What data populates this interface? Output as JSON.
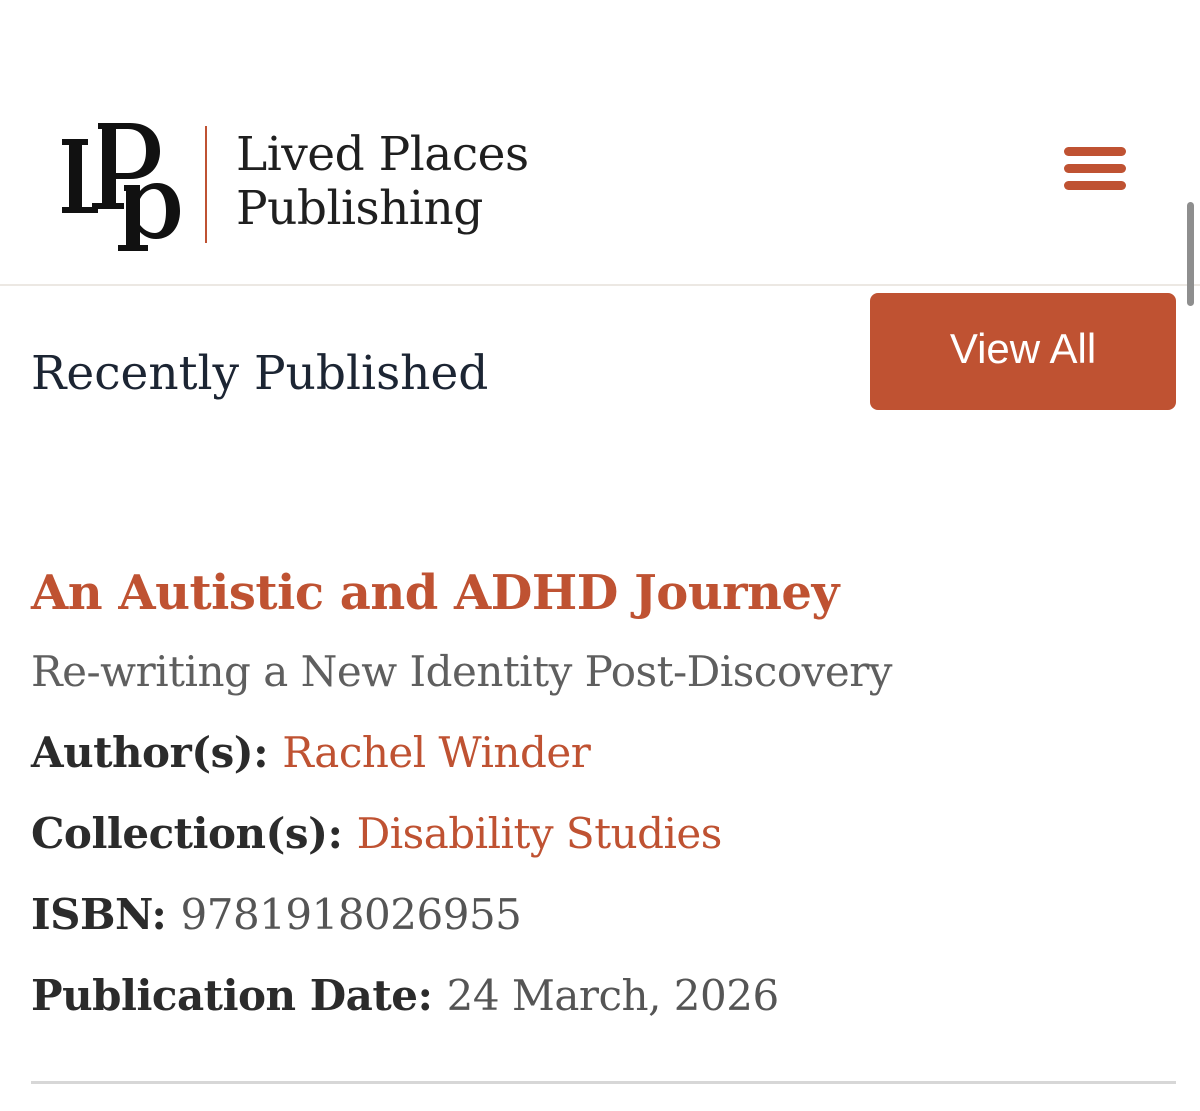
{
  "header": {
    "logo_line1": "Lived Places",
    "logo_line2": "Publishing",
    "menu_icon": "hamburger-menu-icon",
    "accent_color": "#bf5232"
  },
  "section": {
    "title": "Recently Published",
    "view_all_label": "View All"
  },
  "book": {
    "title": "An Autistic and ADHD Journey",
    "subtitle": "Re-writing a New Identity Post-Discovery",
    "author_label": "Author(s):",
    "author": "Rachel Winder",
    "collection_label": "Collection(s):",
    "collection": "Disability Studies",
    "isbn_label": "ISBN:",
    "isbn": "9781918026955",
    "date_label": "Publication Date:",
    "date": "24 March, 2026"
  }
}
